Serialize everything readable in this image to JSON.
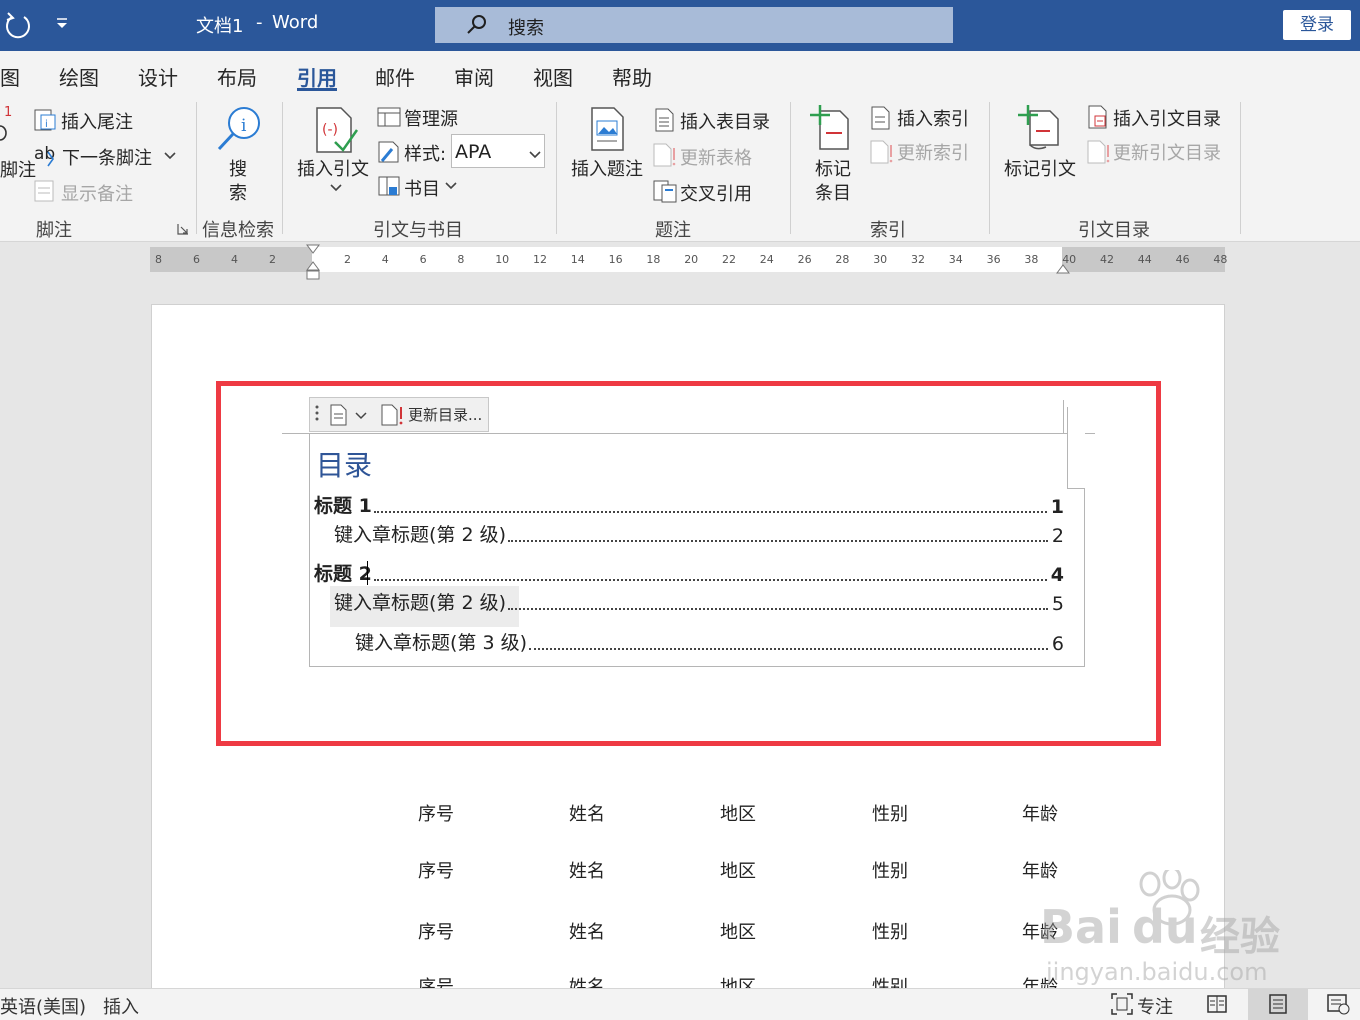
{
  "titlebar": {
    "doc_title": "文档1",
    "separator": "-",
    "app_name": "Word",
    "search_label": "搜索",
    "login": "登录"
  },
  "tabs": [
    "图",
    "绘图",
    "设计",
    "布局",
    "引用",
    "邮件",
    "审阅",
    "视图",
    "帮助"
  ],
  "active_tab": "引用",
  "ribbon": {
    "footnotes": {
      "insert_footnote_fragment": "脚注",
      "insert_endnote": "插入尾注",
      "next_footnote": "下一条脚注",
      "next_footnote_prefix": "ab",
      "show_notes": "显示备注",
      "group": "脚注"
    },
    "research": {
      "search_line1": "搜",
      "search_line2": "索",
      "group": "信息检索"
    },
    "citations": {
      "insert_citation": "插入引文",
      "manage_sources": "管理源",
      "style_label": "样式:",
      "style_value": "APA",
      "bibliography": "书目",
      "group": "引文与书目"
    },
    "captions": {
      "insert_caption": "插入题注",
      "insert_table_of_figures": "插入表目录",
      "update_table": "更新表格",
      "cross_reference": "交叉引用",
      "group": "题注"
    },
    "index": {
      "mark_entry_line1": "标记",
      "mark_entry_line2": "条目",
      "insert_index": "插入索引",
      "update_index": "更新索引",
      "group": "索引"
    },
    "toa": {
      "mark_citation": "标记引文",
      "insert_toa": "插入引文目录",
      "update_toa": "更新引文目录",
      "group": "引文目录"
    }
  },
  "ruler": {
    "left_ticks": [
      "8",
      "6",
      "4",
      "2"
    ],
    "right_ticks": [
      "2",
      "4",
      "6",
      "8",
      "10",
      "12",
      "14",
      "16",
      "18",
      "20",
      "22",
      "24",
      "26",
      "28",
      "30",
      "32",
      "34",
      "36",
      "38",
      "40",
      "42",
      "44",
      "46",
      "48"
    ]
  },
  "toc": {
    "update_button": "更新目录...",
    "title": "目录",
    "entries": [
      {
        "text": "标题 1",
        "page": "1"
      },
      {
        "text": "键入章标题(第 2 级)",
        "page": "2"
      },
      {
        "text": "标题 2",
        "page": "4"
      },
      {
        "text": "键入章标题(第 2 级)",
        "page": "5"
      },
      {
        "text": "键入章标题(第 3 级)",
        "page": "6"
      }
    ]
  },
  "table": {
    "rows": [
      [
        "序号",
        "姓名",
        "地区",
        "性别",
        "年龄"
      ],
      [
        "序号",
        "姓名",
        "地区",
        "性别",
        "年龄"
      ],
      [
        "序号",
        "姓名",
        "地区",
        "性别",
        "年龄"
      ],
      [
        "序号",
        "姓名",
        "地区",
        "性别",
        "年龄"
      ]
    ]
  },
  "watermark": {
    "brand": "Bai",
    "brand2": "du",
    "cn": "经验",
    "url": "jingyan.baidu.com"
  },
  "statusbar": {
    "language": "英语(美国)",
    "mode": "插入",
    "focus": "专注"
  },
  "colors": {
    "title_bar": "#2b579a",
    "highlight_border": "#ee3a43",
    "toc_title": "#2f5597"
  }
}
